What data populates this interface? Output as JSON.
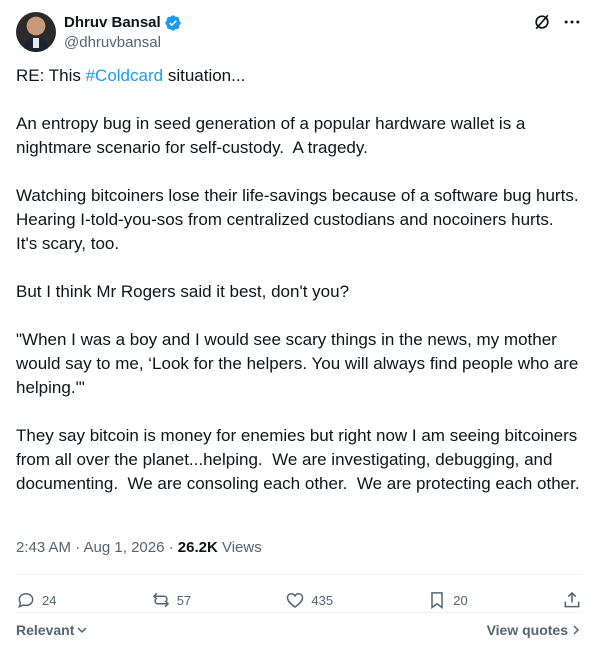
{
  "author": {
    "name": "Dhruv Bansal",
    "handle": "@dhruvbansal"
  },
  "tweet": {
    "line1_prefix": "RE: This ",
    "line1_hashtag": "#Coldcard",
    "line1_suffix": " situation...",
    "paragraphs": [
      "An entropy bug in seed generation of a popular hardware wallet is a nightmare scenario for self-custody.  A tragedy.",
      "Watching bitcoiners lose their life-savings because of a software bug hurts. Hearing I-told-you-sos from centralized custodians and nocoiners hurts.  It's scary, too.",
      "But I think Mr Rogers said it best, don't you?",
      "\"When I was a boy and I would see scary things in the news, my mother would say to me, ‘Look for the helpers. You will always find people who are helping.'\"",
      "They say bitcoin is money for enemies but right now I am seeing bitcoiners from all over the planet...helping.  We are investigating, debugging, and documenting.  We are consoling each other.  We are protecting each other."
    ]
  },
  "meta": {
    "timestamp": "2:43 AM · Aug 1, 2026 · ",
    "views_count": "26.2K",
    "views_label": " Views"
  },
  "actions": {
    "replies": "24",
    "reposts": "57",
    "likes": "435",
    "bookmarks": "20"
  },
  "footer": {
    "relevant": "Relevant",
    "view_quotes": "View quotes"
  },
  "colors": {
    "accent": "#1d9bf0",
    "secondary_text": "#536471",
    "primary_text": "#0f1419"
  }
}
